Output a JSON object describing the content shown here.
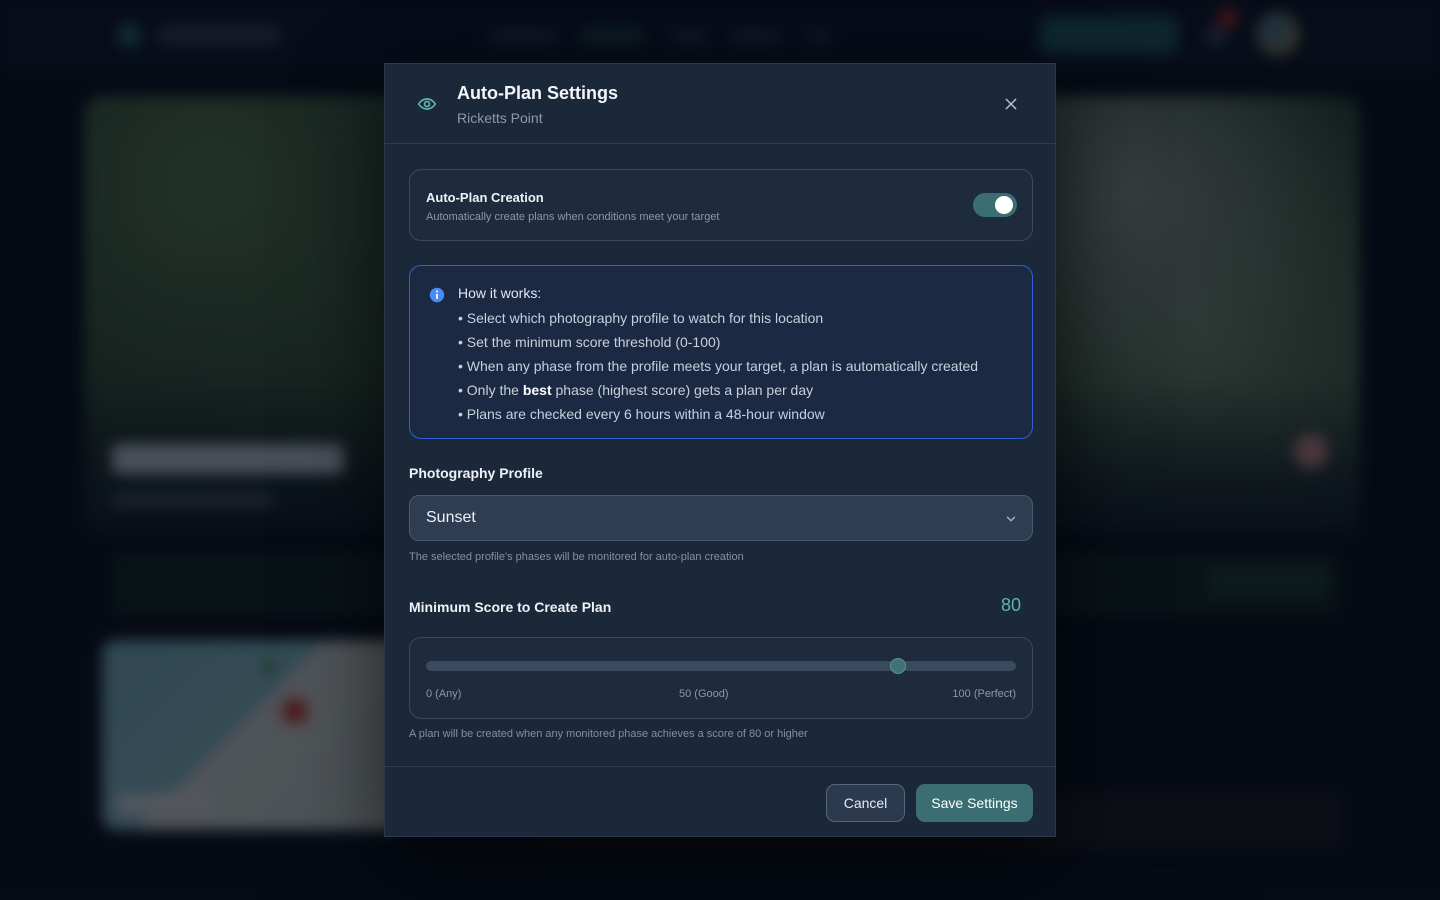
{
  "modal": {
    "title": "Auto-Plan Settings",
    "subtitle": "Ricketts Point",
    "header_icon": "eye-icon",
    "close_icon": "close-icon"
  },
  "auto_plan": {
    "title": "Auto-Plan Creation",
    "description": "Automatically create plans when conditions meet your target",
    "enabled": true
  },
  "info": {
    "icon": "info-icon",
    "heading": "How it works:",
    "items": [
      "• Select which photography profile to watch for this location",
      "• Set the minimum score threshold (0-100)",
      "• When any phase from the profile meets your target, a plan is automatically created",
      {
        "before": "• Only the ",
        "bold": "best",
        "after": " phase (highest score) gets a plan per day"
      },
      "• Plans are checked every 6 hours within a 48-hour window"
    ]
  },
  "profile": {
    "label": "Photography Profile",
    "selected": "Sunset",
    "helper": "The selected profile's phases will be monitored for auto-plan creation"
  },
  "score": {
    "label": "Minimum Score to Create Plan",
    "value": "80",
    "min": 0,
    "max": 100,
    "ticks": [
      "0 (Any)",
      "50 (Good)",
      "100 (Perfect)"
    ],
    "helper": "A plan will be created when any monitored phase achieves a score of 80 or higher"
  },
  "footer": {
    "cancel_label": "Cancel",
    "save_label": "Save Settings"
  },
  "colors": {
    "accent": "#5fb3ad",
    "button_primary": "#3b6e73",
    "info_border": "#2f5fd6",
    "modal_bg": "#1b2839"
  }
}
